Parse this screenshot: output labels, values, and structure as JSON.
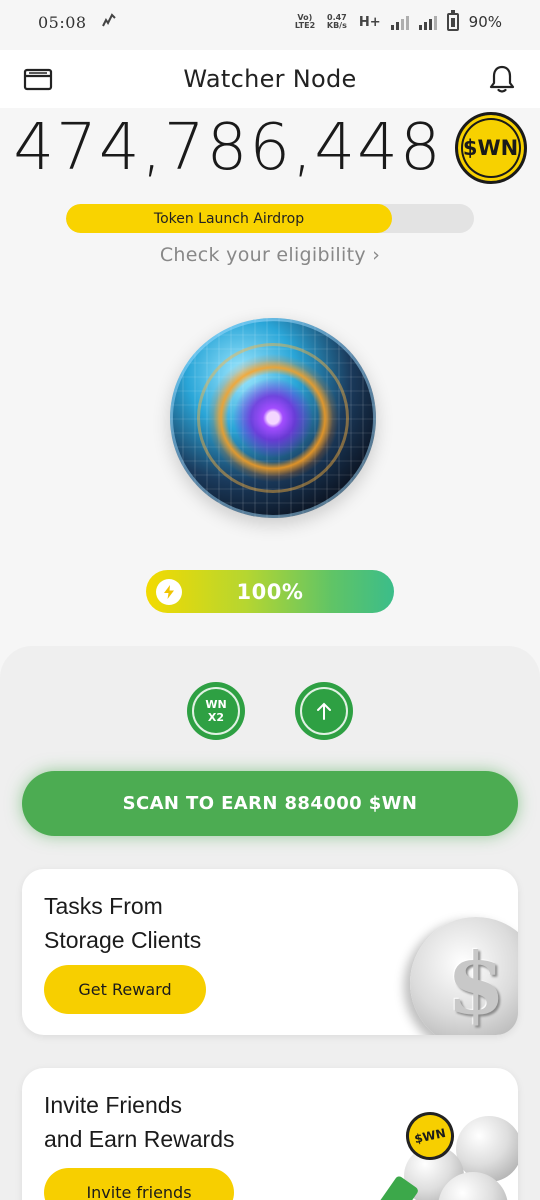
{
  "status_bar": {
    "time": "05:08",
    "net_type": "Vo) LTE2",
    "speed": "0.47 KB/s",
    "signal_label": "H+",
    "battery": "90%"
  },
  "header": {
    "title": "Watcher Node",
    "left_icon": "wallet-icon",
    "right_icon": "bell-icon"
  },
  "balance": {
    "value": "474,786,448",
    "token": "$WN"
  },
  "airdrop": {
    "label": "Token Launch Airdrop",
    "progress": 0.8,
    "link_text": "Check your eligibility ›"
  },
  "energy": {
    "value": "100%",
    "icon": "lightning-icon"
  },
  "actions": {
    "boost_label_top": "WN",
    "boost_label_bottom": "X2",
    "upgrade_icon": "arrow-up-icon",
    "scan_label": "SCAN TO EARN 884000 $WN"
  },
  "cards": {
    "tasks": {
      "title_line1": "Tasks From",
      "title_line2": "Storage Clients",
      "button": "Get Reward"
    },
    "invite": {
      "title_line1": "Invite Friends",
      "title_line2": "and Earn Rewards",
      "button": "Invite friends",
      "coin_label": "$WN"
    }
  },
  "colors": {
    "accent_yellow": "#f7cf00",
    "accent_green": "#4cac52",
    "dark_green": "#2ea043"
  }
}
